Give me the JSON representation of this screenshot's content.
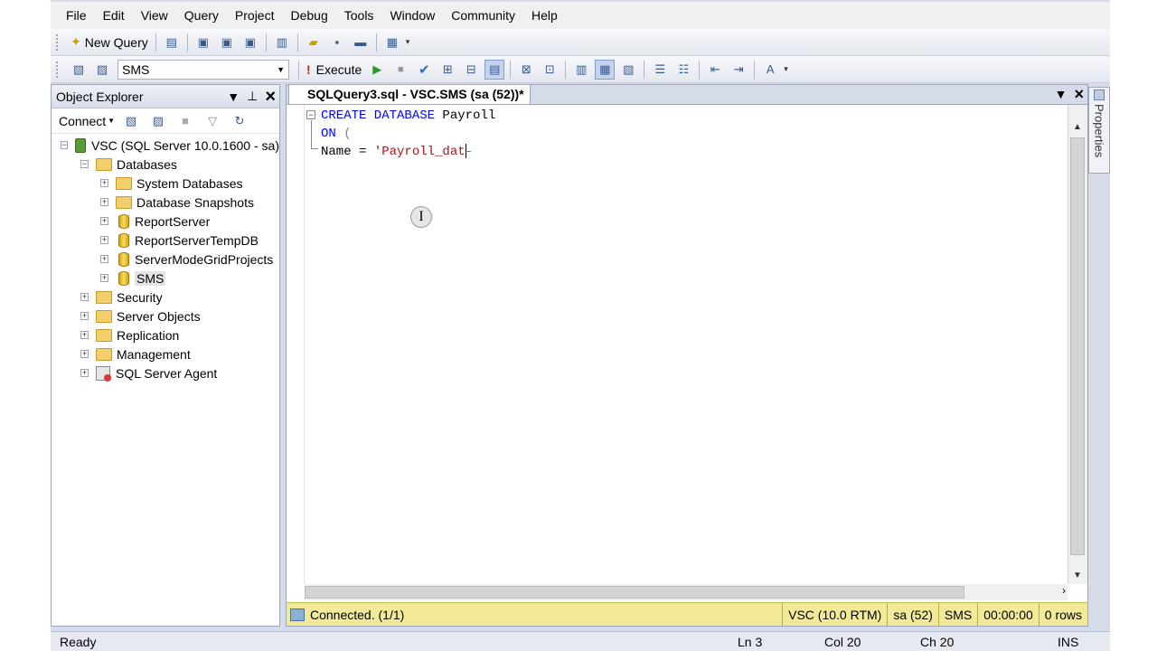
{
  "menu": [
    "File",
    "Edit",
    "View",
    "Query",
    "Project",
    "Debug",
    "Tools",
    "Window",
    "Community",
    "Help"
  ],
  "toolbar": {
    "new_query_label": "New Query",
    "database_selected": "SMS",
    "execute_label": "Execute"
  },
  "object_explorer": {
    "title": "Object Explorer",
    "connect_label": "Connect",
    "server": "VSC (SQL Server 10.0.1600 - sa)",
    "databases_label": "Databases",
    "databases": [
      "System Databases",
      "Database Snapshots",
      "ReportServer",
      "ReportServerTempDB",
      "ServerModeGridProjects",
      "SMS"
    ],
    "server_items": [
      "Security",
      "Server Objects",
      "Replication",
      "Management",
      "SQL Server Agent"
    ]
  },
  "document": {
    "tab_title": "SQLQuery3.sql - VSC.SMS (sa (52))*",
    "code": {
      "line1_kw": "CREATE DATABASE",
      "line1_name": " Payroll",
      "line2_kw": "ON",
      "line2_rest": " (",
      "line3_name": "Name = ",
      "line3_str": "'Payroll_dat"
    }
  },
  "query_status": {
    "connection": "Connected. (1/1)",
    "server": "VSC (10.0 RTM)",
    "user": "sa (52)",
    "database": "SMS",
    "elapsed": "00:00:00",
    "rows": "0 rows"
  },
  "properties_label": "Properties",
  "statusbar": {
    "ready": "Ready",
    "ln": "Ln 3",
    "col": "Col 20",
    "ch": "Ch 20",
    "ins": "INS"
  }
}
